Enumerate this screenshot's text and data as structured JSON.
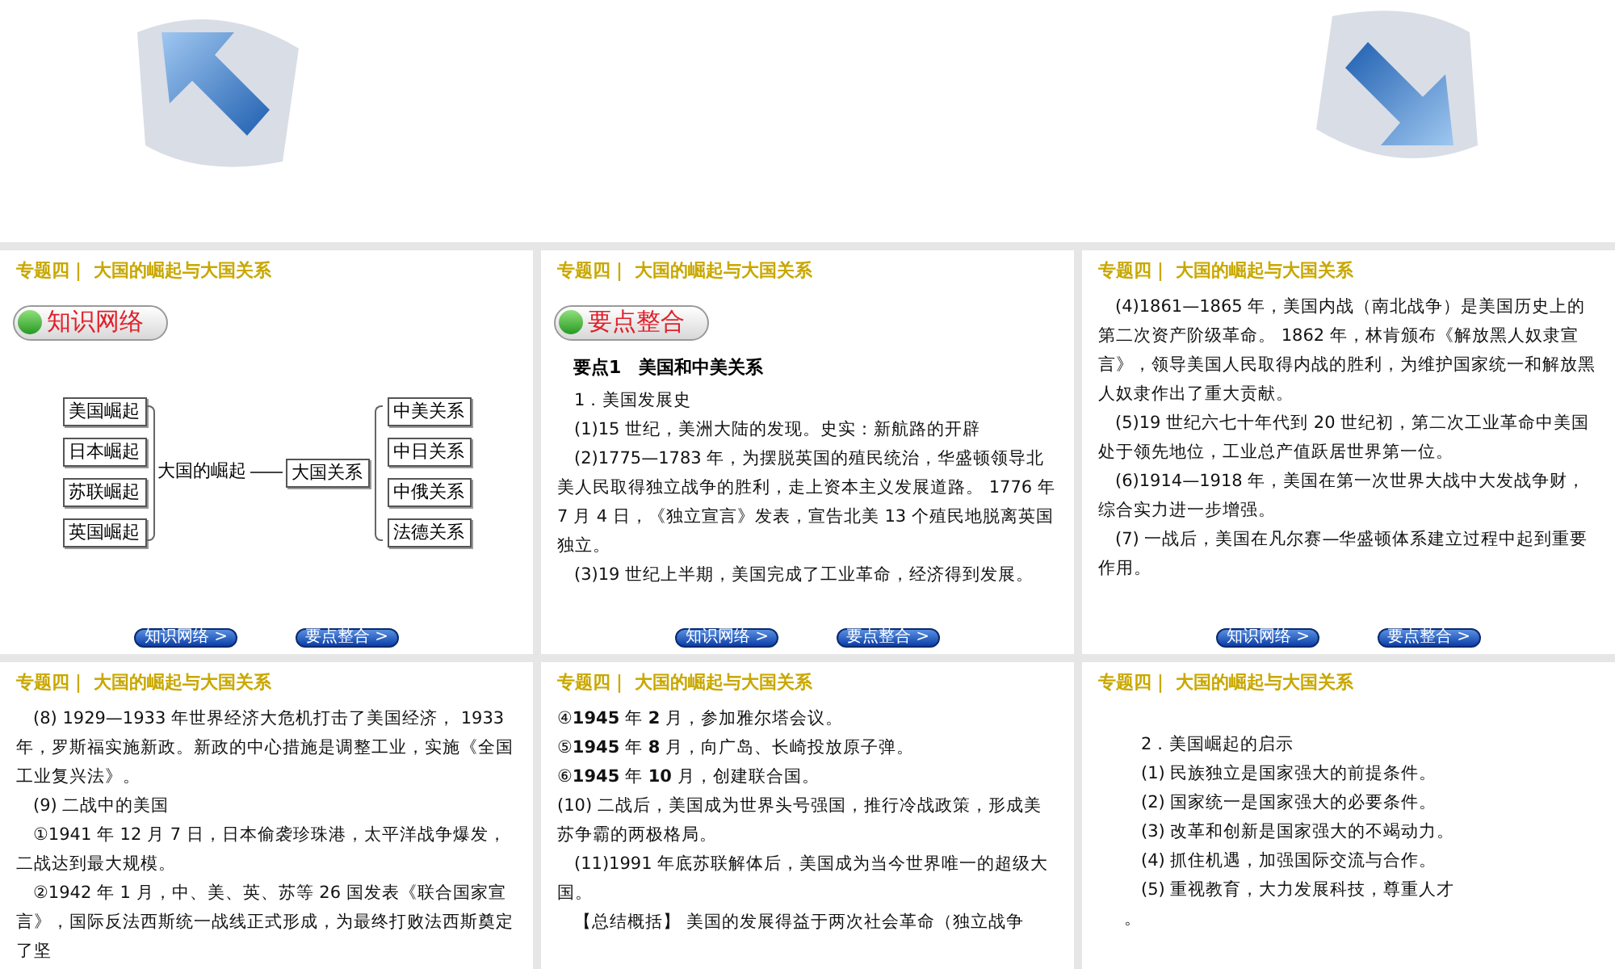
{
  "slides": [
    {
      "kind": "diagram",
      "header": "专题四｜ 大国的崛起与大国关系",
      "badge": "知识网络",
      "left_items": [
        "美国崛起",
        "日本崛起",
        "苏联崛起",
        "英国崛起"
      ],
      "center": "大国的崛起",
      "hub": "大国关系",
      "right_items": [
        "中美关系",
        "中日关系",
        "中俄关系",
        "法德关系"
      ],
      "nav": [
        "知识网络 >",
        "要点整合 >"
      ]
    },
    {
      "kind": "text",
      "header": "专题四｜ 大国的崛起与大国关系",
      "badge": "要点整合",
      "heading": "要点1　美国和中美关系",
      "paragraphs": [
        {
          "text": "1．美国发展史",
          "indent": true
        },
        {
          "text": "(1)15 世纪，美洲大陆的发现。史实：新航路的开辟",
          "indent": true
        },
        {
          "text": "(2)1775—1783 年，为摆脱英国的殖民统治，华盛顿领导北美人民取得独立战争的胜利，走上资本主义发展道路。 1776 年 7 月 4 日，《独立宣言》发表，宣告北美 13 个殖民地脱离英国独立。",
          "indent": true
        },
        {
          "text": "(3)19 世纪上半期，美国完成了工业革命，经济得到发展。",
          "indent": true
        }
      ],
      "nav": [
        "知识网络 >",
        "要点整合 >"
      ]
    },
    {
      "kind": "text",
      "header": "专题四｜ 大国的崛起与大国关系",
      "paragraphs": [
        {
          "text": "(4)1861—1865 年，美国内战（南北战争）是美国历史上的第二次资产阶级革命。 1862 年，林肯颁布《解放黑人奴隶宣言》，领导美国人民取得内战的胜利，为维护国家统一和解放黑人奴隶作出了重大贡献。",
          "indent": true
        },
        {
          "text": "(5)19 世纪六七十年代到 20 世纪初，第二次工业革命中美国处于领先地位，工业总产值跃居世界第一位。",
          "indent": true
        },
        {
          "text": "(6)1914—1918 年，美国在第一次世界大战中大发战争财，综合实力进一步增强。",
          "indent": true
        },
        {
          "text": "(7) 一战后，美国在凡尔赛—华盛顿体系建立过程中起到重要作用。",
          "indent": true
        }
      ],
      "nav": [
        "知识网络 >",
        "要点整合 >"
      ]
    },
    {
      "kind": "text",
      "header": "专题四｜ 大国的崛起与大国关系",
      "paragraphs": [
        {
          "text": "(8) 1929—1933 年世界经济大危机打击了美国经济， 1933 年，罗斯福实施新政。新政的中心措施是调整工业，实施《全国工业复兴法》。",
          "indent": true
        },
        {
          "text": "(9) 二战中的美国",
          "indent": true
        },
        {
          "text": "①1941 年 12 月 7 日，日本偷袭珍珠港，太平洋战争爆发，二战达到最大规模。",
          "indent": true
        },
        {
          "text": "②1942 年 1 月，中、美、英、苏等 26 国发表《联合国家宣言》，国际反法西斯统一战线正式形成，为最终打败法西斯奠定了坚",
          "indent": true
        }
      ]
    },
    {
      "kind": "text",
      "header": "专题四｜ 大国的崛起与大国关系",
      "paragraphs": [
        {
          "text": "④**1945** 年 **2** 月，参加雅尔塔会议。",
          "indent": false
        },
        {
          "text": "⑤**1945** 年 **8** 月，向广岛、长崎投放原子弹。",
          "indent": false
        },
        {
          "text": "⑥**1945** 年 **10** 月，创建联合国。",
          "indent": false
        },
        {
          "text": "(10) 二战后，美国成为世界头号强国，推行冷战政策，形成美苏争霸的两极格局。",
          "indent": false
        },
        {
          "text": "(11)1991 年底苏联解体后，美国成为当今世界唯一的超级大国。",
          "indent": true
        },
        {
          "text": "【总结概括】 美国的发展得益于两次社会革命（独立战争",
          "indent": true
        }
      ]
    },
    {
      "kind": "text",
      "header": "专题四｜ 大国的崛起与大国关系",
      "spaced": true,
      "paragraphs": [
        {
          "text": "2．美国崛起的启示",
          "indent": true
        },
        {
          "text": "(1) 民族独立是国家强大的前提条件。",
          "indent": true
        },
        {
          "text": "(2) 国家统一是国家强大的必要条件。",
          "indent": true
        },
        {
          "text": "(3) 改革和创新是国家强大的不竭动力。",
          "indent": true
        },
        {
          "text": "(4) 抓住机遇，加强国际交流与合作。",
          "indent": true
        },
        {
          "text": "(5) 重视教育，大力发展科技，尊重人才",
          "indent": true
        },
        {
          "text": "。",
          "indent": false
        }
      ]
    }
  ]
}
